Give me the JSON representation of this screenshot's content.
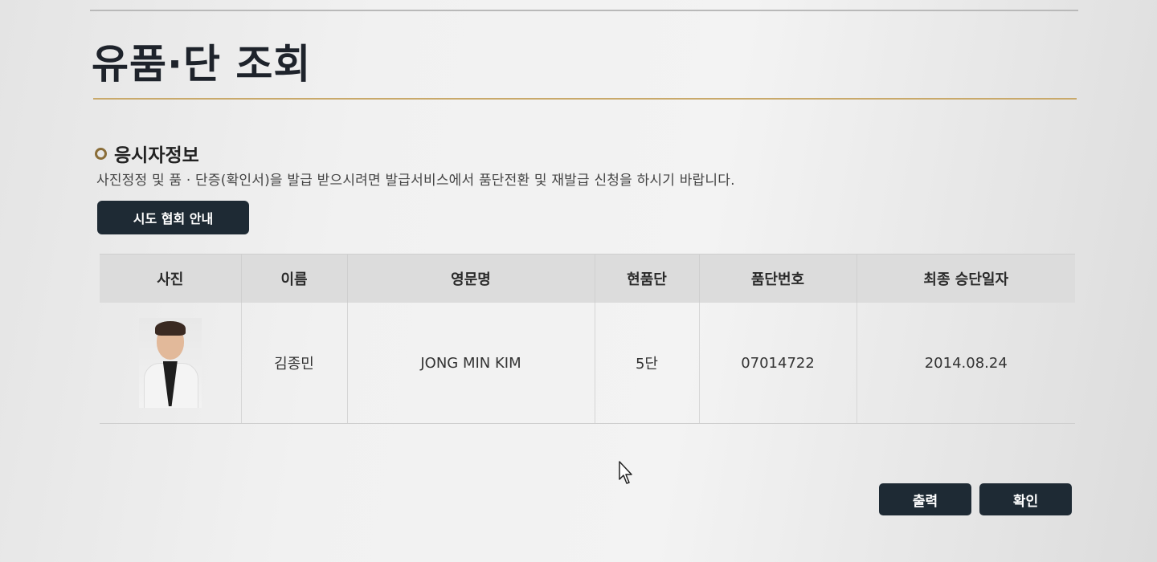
{
  "page": {
    "title": "유품·단 조회"
  },
  "section": {
    "title": "응시자정보",
    "notice": "사진정정 및 품 · 단증(확인서)을 발급 받으시려면 발급서비스에서 품단전환 및 재발급 신청을 하시기 바랍니다."
  },
  "region_button": {
    "label": "시도 협회 안내"
  },
  "table": {
    "headers": [
      "사진",
      "이름",
      "영문명",
      "현품단",
      "품단번호",
      "최종 승단일자"
    ],
    "rows": [
      {
        "photo": "applicant-photo",
        "name": "김종민",
        "english_name": "JONG MIN KIM",
        "rank": "5단",
        "rank_number": "07014722",
        "last_promotion_date": "2014.08.24"
      }
    ]
  },
  "actions": {
    "print_label": "출력",
    "ok_label": "확인"
  },
  "colors": {
    "button_bg": "#1e2a34",
    "accent_rule": "#c9a96b"
  }
}
